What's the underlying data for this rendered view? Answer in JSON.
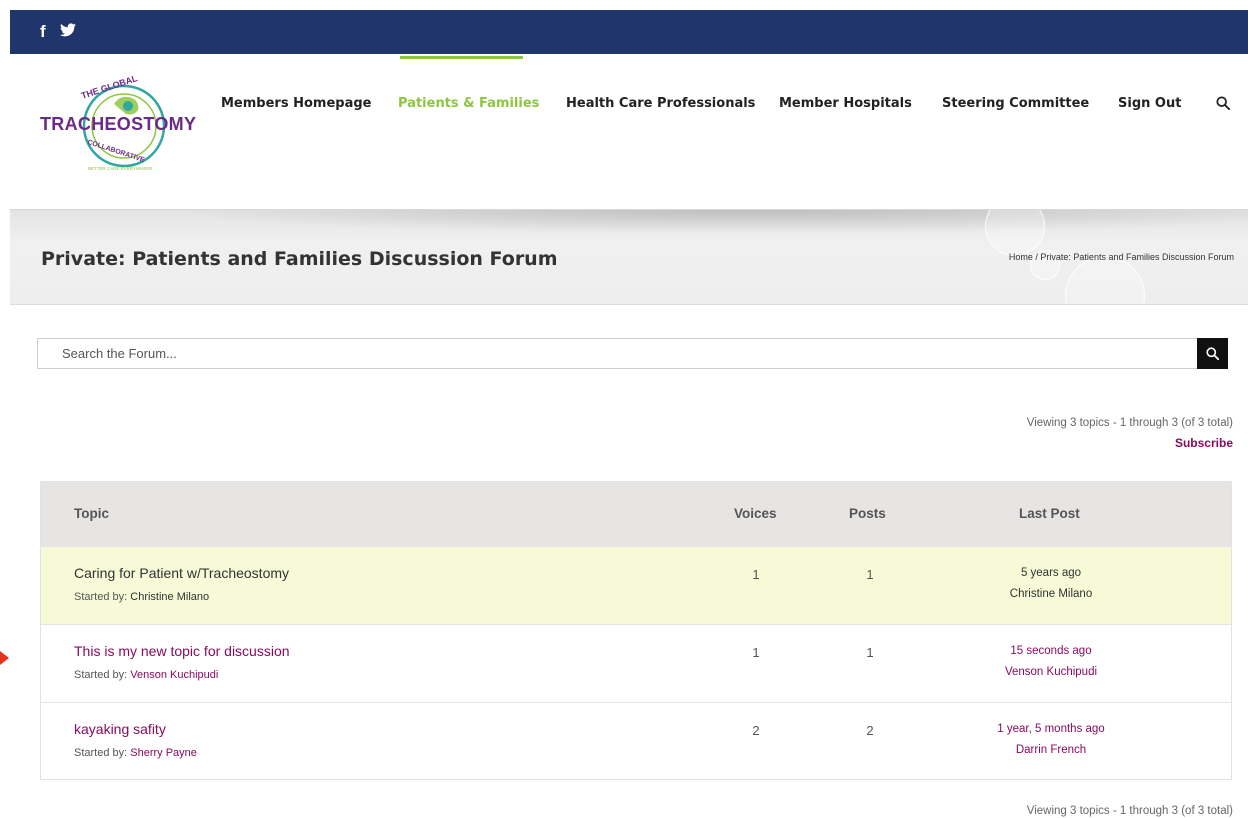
{
  "social": {
    "facebook_icon": "facebook-icon",
    "twitter_icon": "twitter-icon",
    "facebook_glyph": "f"
  },
  "logo": {
    "line1": "THE GLOBAL",
    "line2": "TRACHEOSTOMY",
    "line3": "COLLABORATIVE",
    "tagline": "BETTER CARE EVERYWHERE",
    "colors": {
      "purple": "#6b2a86",
      "green": "#8dc63f",
      "teal": "#2fa6a0"
    }
  },
  "nav": {
    "items": [
      {
        "label": "Members Homepage"
      },
      {
        "label": "Patients & Families"
      },
      {
        "label": "Health Care Professionals"
      },
      {
        "label": "Member Hospitals"
      },
      {
        "label": "Steering Committee"
      },
      {
        "label": "Sign Out"
      }
    ],
    "active_color": "#8dc63f",
    "search_icon": "search-icon"
  },
  "banner": {
    "title": "Private: Patients and Families Discussion Forum",
    "breadcrumb": "Home  /  Private: Patients and Families Discussion Forum"
  },
  "search": {
    "placeholder": "Search the Forum..."
  },
  "pagination": {
    "viewing_text": "Viewing 3 topics - 1 through 3 (of 3 total)",
    "subscribe_label": "Subscribe"
  },
  "table": {
    "headers": {
      "topic": "Topic",
      "voices": "Voices",
      "posts": "Posts",
      "last_post": "Last Post"
    },
    "rows": [
      {
        "title": "Caring for Patient w/Tracheostomy",
        "started_prefix": "Started by:",
        "author": "Christine Milano",
        "voices": "1",
        "posts": "1",
        "last_time": "5 years ago",
        "last_author": "Christine Milano"
      },
      {
        "title": "This is my new topic for discussion",
        "started_prefix": "Started by:",
        "author": "Venson Kuchipudi",
        "voices": "1",
        "posts": "1",
        "last_time": "15 seconds ago",
        "last_author": "Venson Kuchipudi"
      },
      {
        "title": "kayaking safity",
        "started_prefix": "Started by:",
        "author": "Sherry Payne",
        "voices": "2",
        "posts": "2",
        "last_time": "1 year, 5 months ago",
        "last_author": "Darrin French"
      }
    ]
  },
  "colors": {
    "header_bar": "#1f356b",
    "link": "#8a0a5e",
    "highlight_row": "#f6fad6",
    "pointer_arrow": "#e8311a"
  }
}
